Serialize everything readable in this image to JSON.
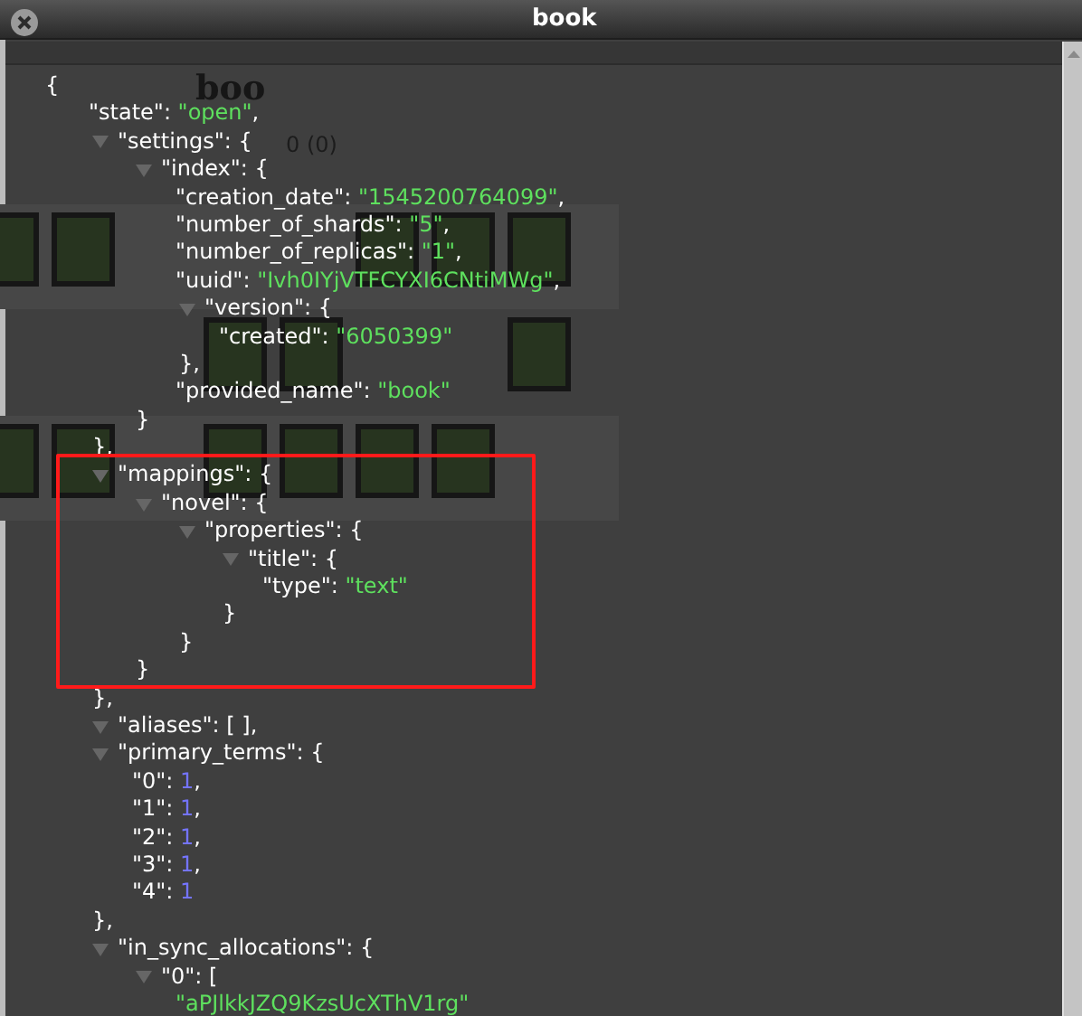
{
  "dialog": {
    "title": "book"
  },
  "background": {
    "index_name": "boo",
    "docs": "0 (0)"
  },
  "tree": {
    "kind": "branch",
    "label": "{",
    "children": [
      {
        "kind": "string",
        "key": "\"state\": ",
        "value": "\"open\"",
        "trail": ","
      },
      {
        "kind": "branch",
        "expanded": true,
        "label": "\"settings\": {",
        "close": "},",
        "children": [
          {
            "kind": "branch",
            "expanded": true,
            "label": "\"index\": {",
            "close": "}",
            "children": [
              {
                "kind": "string",
                "key": "\"creation_date\": ",
                "value": "\"1545200764099\"",
                "trail": ","
              },
              {
                "kind": "string",
                "key": "\"number_of_shards\": ",
                "value": "\"5\"",
                "trail": ","
              },
              {
                "kind": "string",
                "key": "\"number_of_replicas\": ",
                "value": "\"1\"",
                "trail": ","
              },
              {
                "kind": "string",
                "key": "\"uuid\": ",
                "value": "\"Ivh0IYjVTFCYXI6CNtiMWg\"",
                "trail": ","
              },
              {
                "kind": "branch",
                "expanded": true,
                "label": "\"version\": {",
                "close": "},",
                "children": [
                  {
                    "kind": "string",
                    "key": "\"created\": ",
                    "value": "\"6050399\""
                  }
                ]
              },
              {
                "kind": "string",
                "key": "\"provided_name\": ",
                "value": "\"book\""
              }
            ]
          }
        ]
      },
      {
        "kind": "branch",
        "expanded": true,
        "label": "\"mappings\": {",
        "close": "},",
        "children": [
          {
            "kind": "branch",
            "expanded": true,
            "label": "\"novel\": {",
            "close": "}",
            "children": [
              {
                "kind": "branch",
                "expanded": true,
                "label": "\"properties\": {",
                "close": "}",
                "children": [
                  {
                    "kind": "branch",
                    "expanded": true,
                    "label": "\"title\": {",
                    "close": "}",
                    "children": [
                      {
                        "kind": "string",
                        "key": "\"type\": ",
                        "value": "\"text\""
                      }
                    ]
                  }
                ]
              }
            ]
          }
        ]
      },
      {
        "kind": "branch",
        "expanded": true,
        "label": "\"aliases\": [ ],"
      },
      {
        "kind": "branch",
        "expanded": true,
        "label": "\"primary_terms\": {",
        "close": "},",
        "children": [
          {
            "kind": "number",
            "key": "\"0\": ",
            "value": "1",
            "trail": ","
          },
          {
            "kind": "number",
            "key": "\"1\": ",
            "value": "1",
            "trail": ","
          },
          {
            "kind": "number",
            "key": "\"2\": ",
            "value": "1",
            "trail": ","
          },
          {
            "kind": "number",
            "key": "\"3\": ",
            "value": "1",
            "trail": ","
          },
          {
            "kind": "number",
            "key": "\"4\": ",
            "value": "1"
          }
        ]
      },
      {
        "kind": "branch",
        "expanded": true,
        "label": "\"in_sync_allocations\": {",
        "children": [
          {
            "kind": "branch",
            "expanded": true,
            "label": "\"0\": [",
            "children": [
              {
                "kind": "string",
                "value": "\"aPJlkkJZQ9KzsUcXThV1rg\""
              }
            ]
          }
        ]
      }
    ]
  },
  "highlight": true
}
